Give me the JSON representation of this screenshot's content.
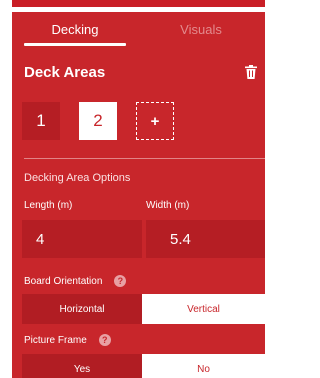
{
  "tabs": [
    {
      "label": "Decking",
      "active": true
    },
    {
      "label": "Visuals",
      "active": false
    }
  ],
  "deck_areas": {
    "title": "Deck Areas",
    "delete_icon": "trash-icon",
    "areas": [
      {
        "label": "1",
        "selected": false
      },
      {
        "label": "2",
        "selected": true
      }
    ],
    "add_label": "+"
  },
  "options": {
    "title": "Decking Area Options",
    "length": {
      "label": "Length (m)",
      "value": "4"
    },
    "width": {
      "label": "Width (m)",
      "value": "5.4"
    },
    "board_orientation": {
      "label": "Board Orientation",
      "help_icon": "help-icon",
      "help_glyph": "?",
      "choices": [
        "Horizontal",
        "Vertical"
      ],
      "selected": "Vertical"
    },
    "picture_frame": {
      "label": "Picture Frame",
      "help_icon": "help-icon",
      "help_glyph": "?",
      "choices": [
        "Yes",
        "No"
      ],
      "selected": "No"
    }
  },
  "colors": {
    "panel": "#c8262b",
    "panel_dark": "#b51e24",
    "accent_white": "#ffffff"
  }
}
